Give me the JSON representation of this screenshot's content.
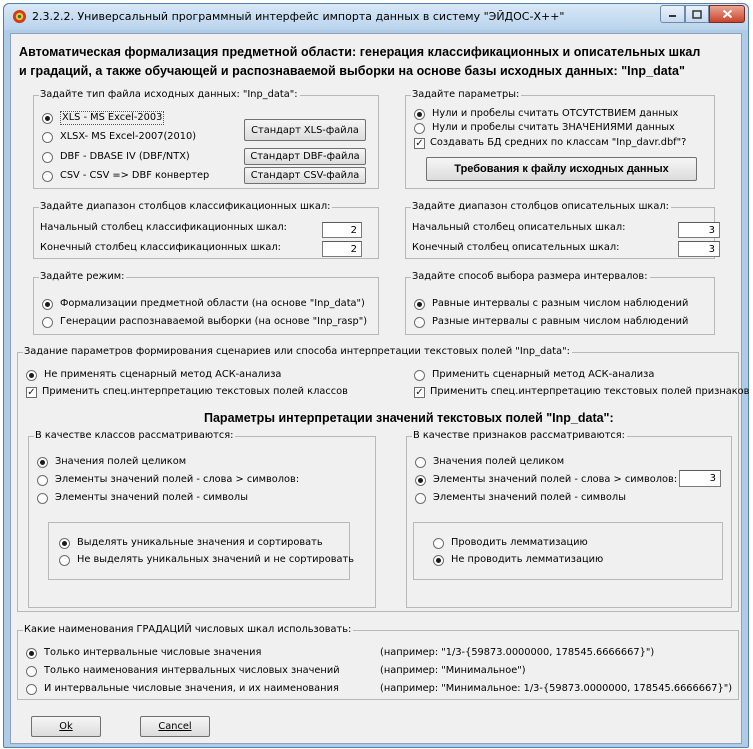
{
  "window": {
    "title": "2.3.2.2. Универсальный программный интерфейс импорта данных в систему \"ЭЙДОС-Х++\""
  },
  "heading": {
    "line1": "Автоматическая формализация предметной области: генерация классификационных и описательных шкал",
    "line2": "и градаций,  а также обучающей и распознаваемой выборки  на  основе  базы исходных данных: \"Inp_data\""
  },
  "file_type": {
    "label": "Задайте тип файла исходных данных: \"Inp_data\":",
    "options": [
      "XLS  - MS Excel-2003",
      "XLSX- MS Excel-2007(2010)",
      "DBF  - DBASE IV (DBF/NTX)",
      "CSV  - CSV => DBF конвертер"
    ],
    "selected": 0,
    "buttons": [
      "Стандарт XLS-файла",
      "Стандарт DBF-файла",
      "Стандарт CSV-файла"
    ]
  },
  "params": {
    "label": "Задайте параметры:",
    "options": [
      "Нули и пробелы считать ОТСУТСТВИЕМ данных",
      "Нули и пробелы считать ЗНАЧЕНИЯМИ  данных"
    ],
    "selected": 0,
    "checkbox": "Создавать БД средних по классам \"Inp_davr.dbf\"?",
    "checkbox_checked": true,
    "req_button": "Требования к файлу исходных данных"
  },
  "class_range": {
    "label": "Задайте диапазон столбцов классификационных шкал:",
    "start_label": "Начальный столбец классификационных шкал:",
    "start_value": "2",
    "end_label": "Конечный  столбец классификационных шкал:",
    "end_value": "2"
  },
  "desc_range": {
    "label": "Задайте диапазон столбцов описательных шкал:",
    "start_label": "Начальный столбец описательных шкал:",
    "start_value": "3",
    "end_label": "Конечный  столбец описательных шкал:",
    "end_value": "3"
  },
  "mode": {
    "label": "Задайте режим:",
    "options": [
      "Формализации предметной  области (на основе \"Inp_data\")",
      "Генерации распознаваемой выборки (на основе \"Inp_rasp\")"
    ],
    "selected": 0
  },
  "intervals": {
    "label": "Задайте способ выбора размера интервалов:",
    "options": [
      "Равные интервалы с разным числом наблюдений",
      "Разные интервалы с равным числом наблюдений"
    ],
    "selected": 0
  },
  "scenario": {
    "label": "Задание параметров формирования сценариев или способа интерпретации текстовых полей \"Inp_data\":",
    "radio_left": "Не применять сценарный метод АСК-анализа",
    "radio_right": "Применить сценарный метод АСК-анализа",
    "selected": 0,
    "check_left": "Применить спец.интерпретацию текстовых полей классов",
    "check_right": "Применить спец.интерпретацию текстовых полей признаков",
    "subheading": "Параметры интерпретации значений текстовых полей \"Inp_data\":"
  },
  "classes": {
    "label": "В качестве классов рассматриваются:",
    "options": [
      "Значения полей целиком",
      "Элементы значений полей - слова > символов:",
      "Элементы значений полей - символы"
    ],
    "selected": 0,
    "sort_options": [
      "Выделять уникальные значения и сортировать",
      "Не выделять уникальных значений и не сортировать"
    ],
    "sort_selected": 0
  },
  "features": {
    "label": "В качестве признаков рассматриваются:",
    "options": [
      "Значения полей целиком",
      "Элементы значений полей - слова > символов:",
      "Элементы значений полей - символы"
    ],
    "selected": 1,
    "word_len": "3",
    "lemma_options": [
      "Проводить лемматизацию",
      "Не проводить лемматизацию"
    ],
    "lemma_selected": 1
  },
  "gradations": {
    "label": "Какие наименования ГРАДАЦИЙ числовых шкал использовать:",
    "options": [
      "Только интервальные числовые значения",
      "Только наименования интервальных числовых значений",
      "И интервальные числовые значения, и их наименования"
    ],
    "examples": [
      "(например: \"1/3-{59873.0000000, 178545.6666667}\")",
      "(например: \"Минимальное\")",
      "(например: \"Минимальное: 1/3-{59873.0000000, 178545.6666667}\")"
    ],
    "selected": 0
  },
  "footer": {
    "ok": "Ok",
    "cancel": "Cancel"
  }
}
